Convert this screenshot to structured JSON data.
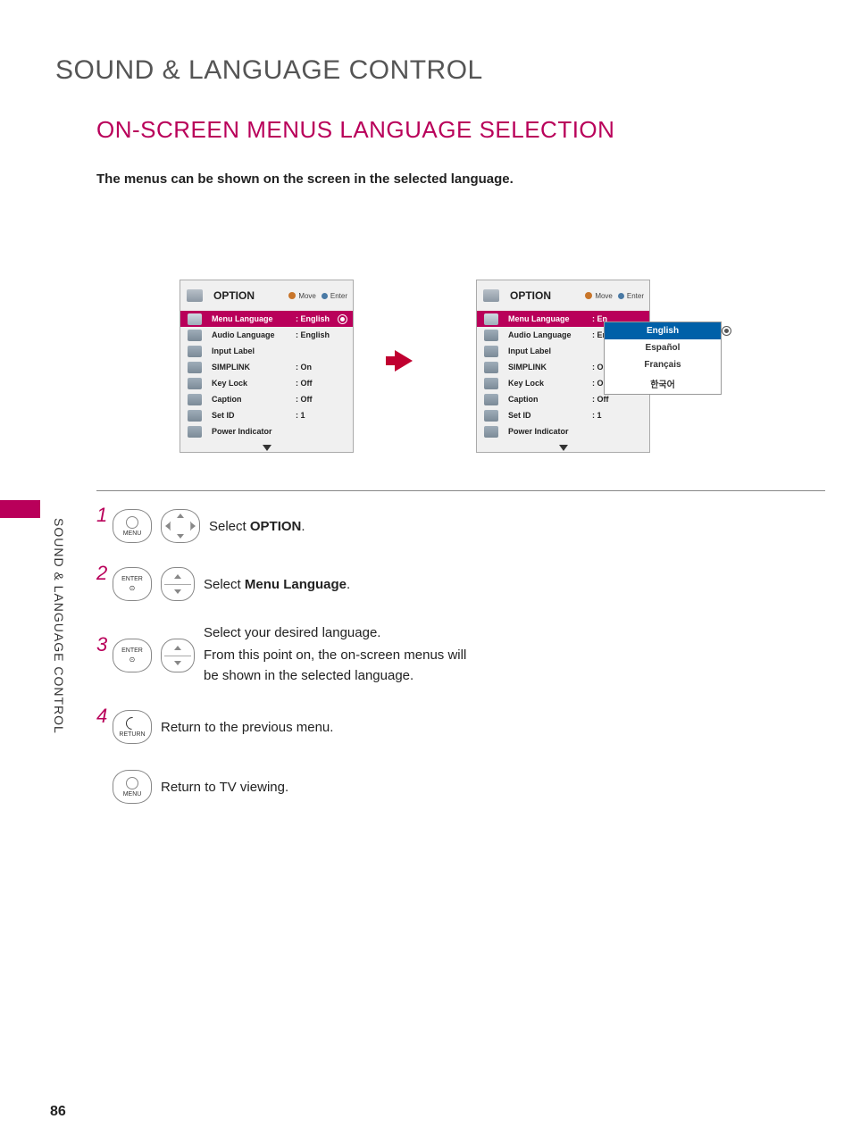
{
  "headings": {
    "section": "SOUND & LANGUAGE CONTROL",
    "title": "ON-SCREEN MENUS LANGUAGE SELECTION",
    "side_label": "SOUND & LANGUAGE CONTROL"
  },
  "intro": "The menus can be shown on the screen in the selected language.",
  "page_number": "86",
  "osd": {
    "title": "OPTION",
    "hint_move": "Move",
    "hint_enter": "Enter",
    "rows": [
      {
        "label": "Menu Language",
        "value": ": English",
        "selected": true,
        "radio": true,
        "right_value": ": En"
      },
      {
        "label": "Audio Language",
        "value": ": English",
        "selected": false,
        "radio": false,
        "right_value": ": En"
      },
      {
        "label": "Input Label",
        "value": "",
        "selected": false,
        "radio": false,
        "right_value": ""
      },
      {
        "label": "SIMPLINK",
        "value": ": On",
        "selected": false,
        "radio": false,
        "right_value": ": O"
      },
      {
        "label": "Key Lock",
        "value": ": Off",
        "selected": false,
        "radio": false,
        "right_value": ": O"
      },
      {
        "label": "Caption",
        "value": ": Off",
        "selected": false,
        "radio": false,
        "right_value": ": Off"
      },
      {
        "label": "Set ID",
        "value": ": 1",
        "selected": false,
        "radio": false,
        "right_value": ": 1"
      },
      {
        "label": "Power Indicator",
        "value": "",
        "selected": false,
        "radio": false,
        "right_value": ""
      }
    ]
  },
  "dropdown": {
    "options": [
      "English",
      "Español",
      "Français",
      "한국어"
    ],
    "selected_index": 0
  },
  "steps": {
    "s1_num": "1",
    "s1_btn": "MENU",
    "s1_pre": "Select ",
    "s1_bold": "OPTION",
    "s1_post": ".",
    "s2_num": "2",
    "s2_btn": "ENTER",
    "s2_pre": "Select ",
    "s2_bold": "Menu Language",
    "s2_post": ".",
    "s3_num": "3",
    "s3_btn": "ENTER",
    "s3_line1": "Select your desired language.",
    "s3_line2": "From this point on, the on-screen menus will be shown in the selected language.",
    "s4_num": "4",
    "s4_btn": "RETURN",
    "s4_text": "Return to the previous menu.",
    "s5_btn": "MENU",
    "s5_text": "Return to TV viewing."
  }
}
